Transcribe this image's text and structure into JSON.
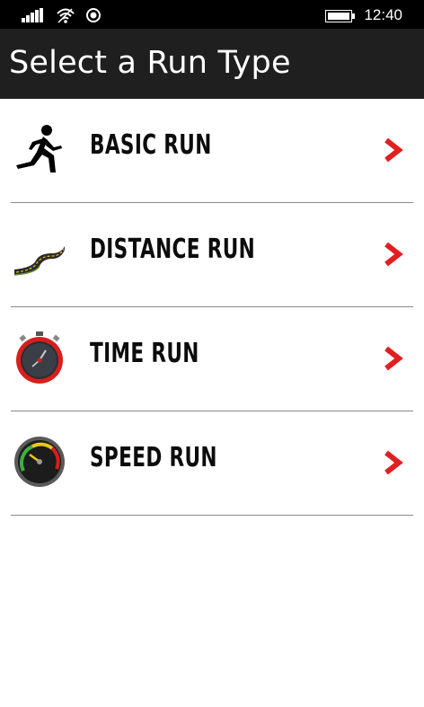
{
  "status_bar": {
    "time": "12:40",
    "icons": [
      "signal-icon",
      "wifi-icon",
      "location-icon",
      "battery-icon"
    ]
  },
  "header": {
    "title": "Select a Run Type"
  },
  "run_types": [
    {
      "label": "BASIC RUN",
      "icon": "runner-icon"
    },
    {
      "label": "DISTANCE RUN",
      "icon": "road-icon"
    },
    {
      "label": "TIME RUN",
      "icon": "stopwatch-icon"
    },
    {
      "label": "SPEED RUN",
      "icon": "speedometer-icon"
    }
  ],
  "colors": {
    "accent": "#e02020",
    "header_bg": "#1f1f1f",
    "status_bg": "#000000",
    "text": "#0c0c0c"
  }
}
